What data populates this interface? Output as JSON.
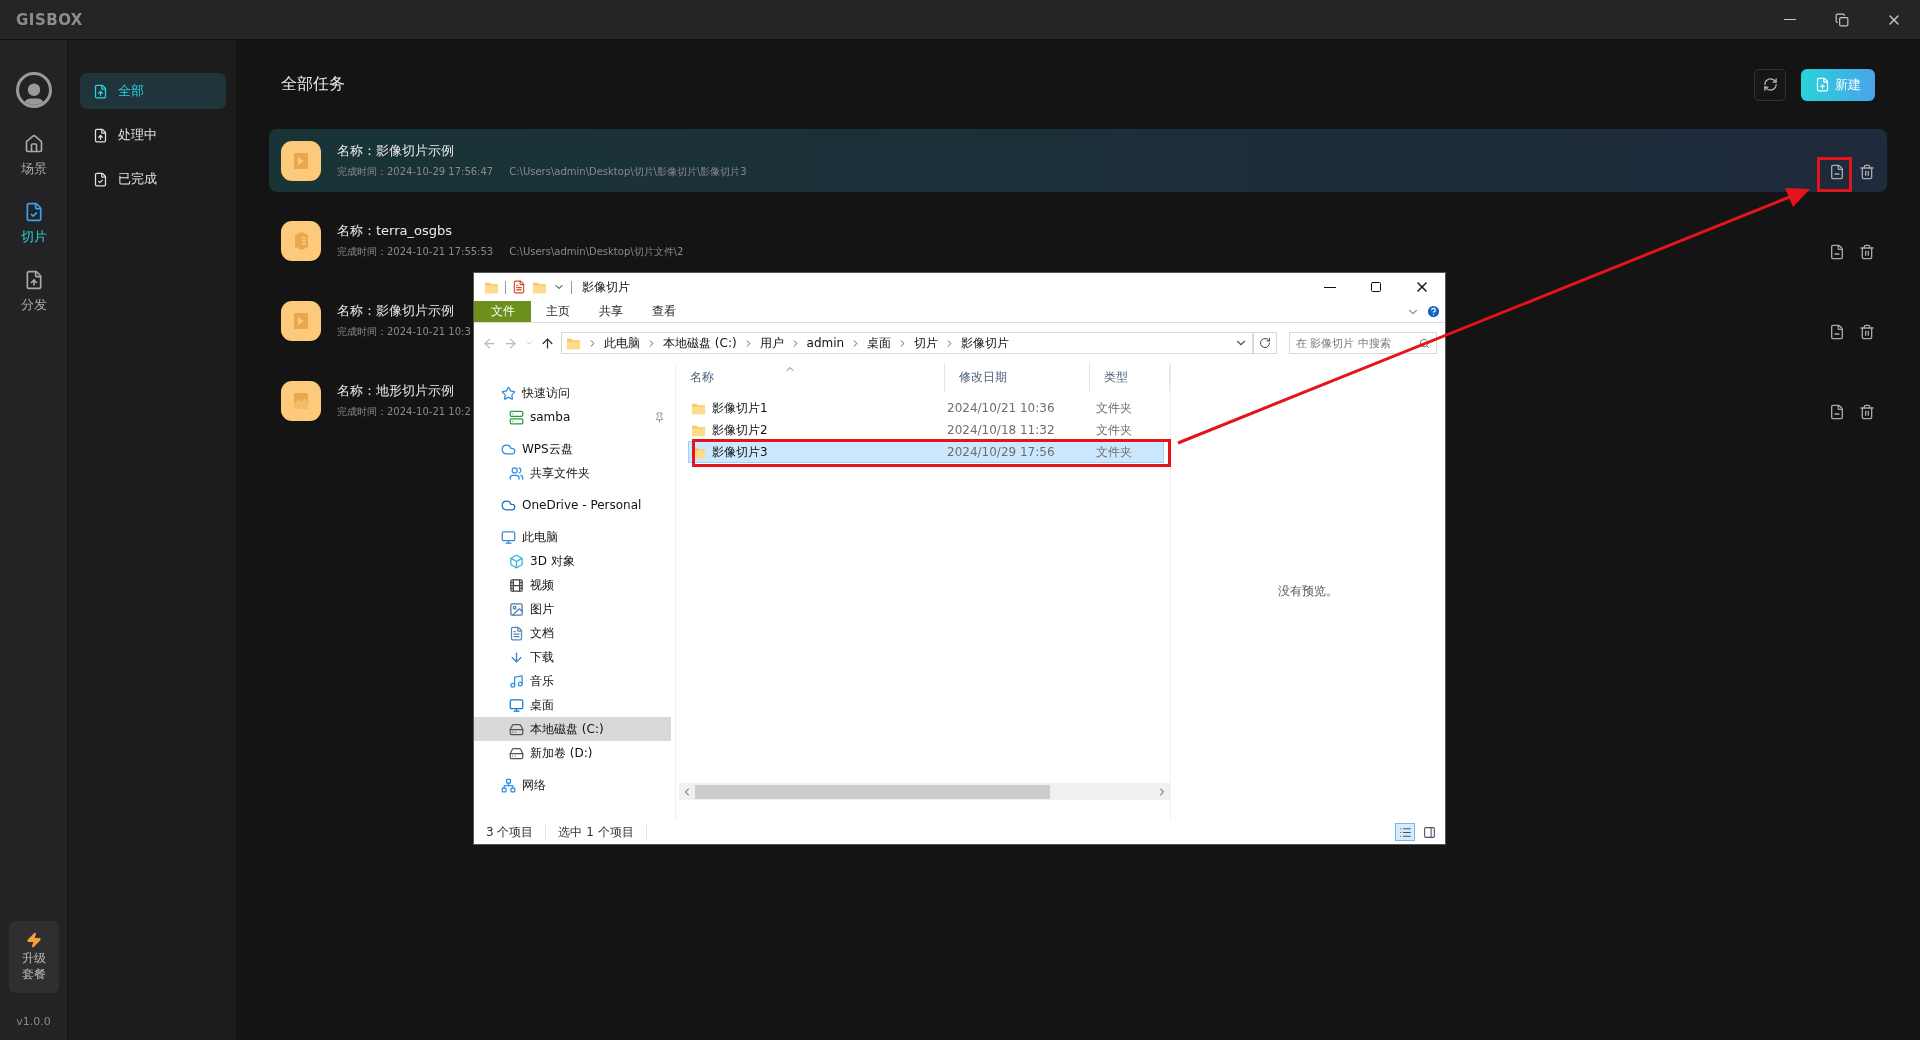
{
  "app": {
    "logo": "GISBOX"
  },
  "rail": {
    "items": [
      {
        "label": "场景",
        "selected": false
      },
      {
        "label": "切片",
        "selected": true
      },
      {
        "label": "分发",
        "selected": false
      }
    ],
    "upgrade": "升级套餐",
    "version": "v1.0.0"
  },
  "nav": [
    {
      "label": "全部",
      "selected": true
    },
    {
      "label": "处理中",
      "selected": false
    },
    {
      "label": "已完成",
      "selected": false
    }
  ],
  "main": {
    "title": "全部任务",
    "new_button": "新建"
  },
  "tasks": [
    {
      "kind": "imagery",
      "name": "名称：影像切片示例",
      "time": "完成时间：2024-10-29 17:56:47",
      "path": "C:\\Users\\admin\\Desktop\\切片\\影像切片\\影像切片3",
      "selected": true
    },
    {
      "kind": "model",
      "name": "名称：terra_osgbs",
      "time": "完成时间：2024-10-21 17:55:53",
      "path": "C:\\Users\\admin\\Desktop\\切片文件\\2",
      "selected": false
    },
    {
      "kind": "imagery",
      "name": "名称：影像切片示例",
      "time": "完成时间：2024-10-21 10:3",
      "selected": false
    },
    {
      "kind": "terrain",
      "name": "名称：地形切片示例",
      "time": "完成时间：2024-10-21 10:2",
      "selected": false
    }
  ],
  "explorer": {
    "title": "影像切片",
    "file_menu": "文件",
    "ribbon_tabs": [
      "主页",
      "共享",
      "查看"
    ],
    "breadcrumb": [
      "此电脑",
      "本地磁盘 (C:)",
      "用户",
      "admin",
      "桌面",
      "切片",
      "影像切片"
    ],
    "search": {
      "placeholder": "在 影像切片 中搜索"
    },
    "tree": [
      {
        "label": "快速访问",
        "selected": false,
        "children": [
          {
            "label": "samba",
            "selected": false,
            "pinned": true
          }
        ]
      },
      {
        "label": "WPS云盘",
        "selected": false,
        "children": [
          {
            "label": "共享文件夹",
            "selected": false
          }
        ]
      },
      {
        "label": "OneDrive - Personal",
        "selected": false
      },
      {
        "label": "此电脑",
        "selected": false,
        "children": [
          {
            "label": "3D 对象",
            "selected": false
          },
          {
            "label": "视频",
            "selected": false
          },
          {
            "label": "图片",
            "selected": false
          },
          {
            "label": "文档",
            "selected": false
          },
          {
            "label": "下载",
            "selected": false
          },
          {
            "label": "音乐",
            "selected": false
          },
          {
            "label": "桌面",
            "selected": false
          },
          {
            "label": "本地磁盘 (C:)",
            "selected": true
          },
          {
            "label": "新加卷 (D:)",
            "selected": false
          }
        ]
      },
      {
        "label": "网络",
        "selected": false
      }
    ],
    "columns": [
      "名称",
      "修改日期",
      "类型"
    ],
    "files": [
      {
        "name": "影像切片1",
        "modified": "2024/10/21 10:36",
        "type": "文件夹",
        "selected": false
      },
      {
        "name": "影像切片2",
        "modified": "2024/10/18 11:32",
        "type": "文件夹",
        "selected": false
      },
      {
        "name": "影像切片3",
        "modified": "2024/10/29 17:56",
        "type": "文件夹",
        "selected": true
      }
    ],
    "preview": "没有预览。",
    "status": [
      "3 个项目",
      "选中 1 个项目"
    ]
  }
}
